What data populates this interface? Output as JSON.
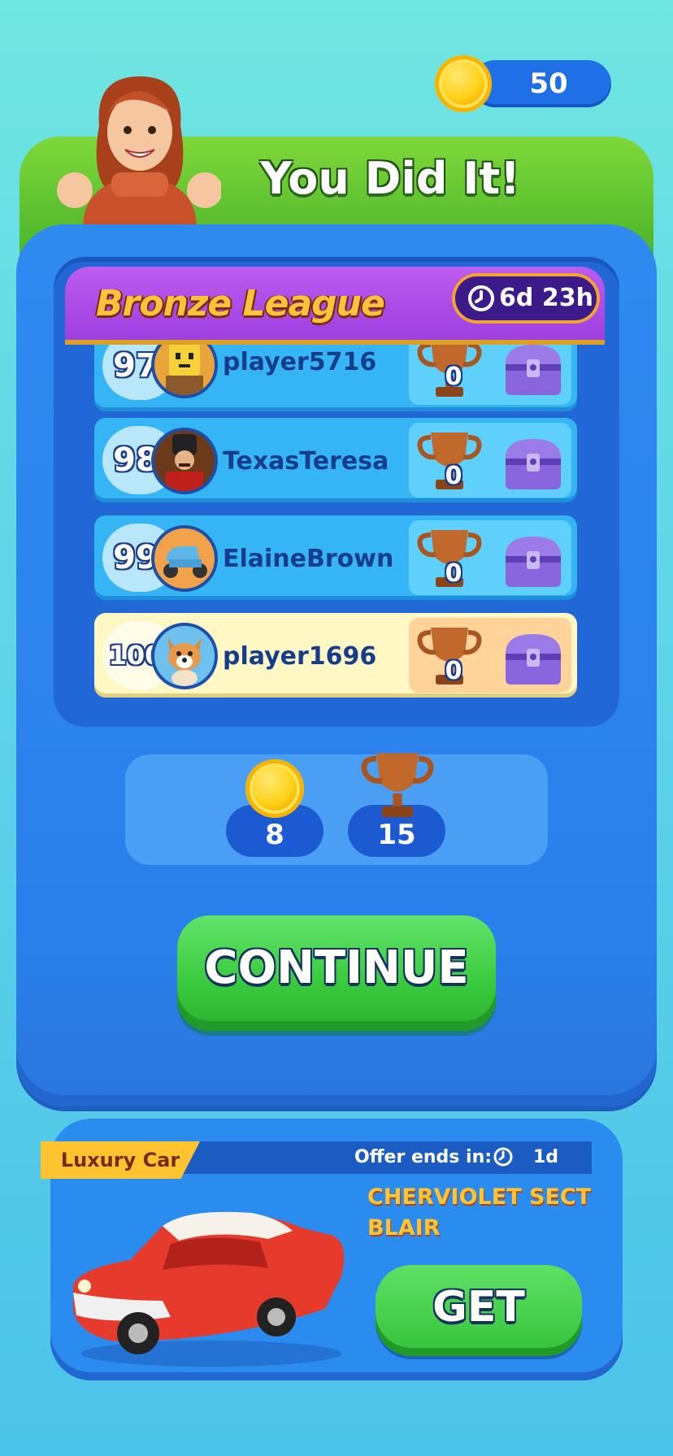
{
  "top_bar": {
    "coins": "50"
  },
  "header": {
    "title": "You Did It!"
  },
  "league": {
    "title": "Bronze League",
    "timer": "6d 23h"
  },
  "rows": [
    {
      "rank": "97",
      "name": "player5716",
      "trophies": "0"
    },
    {
      "rank": "98",
      "name": "TexasTeresa",
      "trophies": "0"
    },
    {
      "rank": "99",
      "name": "ElaineBrown",
      "trophies": "0"
    },
    {
      "rank": "100",
      "name": "player1696",
      "trophies": "0",
      "highlight": true
    }
  ],
  "summary": {
    "coins": "8",
    "trophies": "15"
  },
  "continue_label": "CONTINUE",
  "offer": {
    "tag": "Luxury Car",
    "ends_label": "Offer ends in:",
    "ends_time": "1d",
    "car_name_line1": "CHERVIOLET SECT",
    "car_name_line2": "BLAIR",
    "button": "GET"
  },
  "colors": {
    "panel": "#2f8af0",
    "green": "#39c93d",
    "gold": "#ffc23a",
    "purple": "#a94ae6"
  }
}
